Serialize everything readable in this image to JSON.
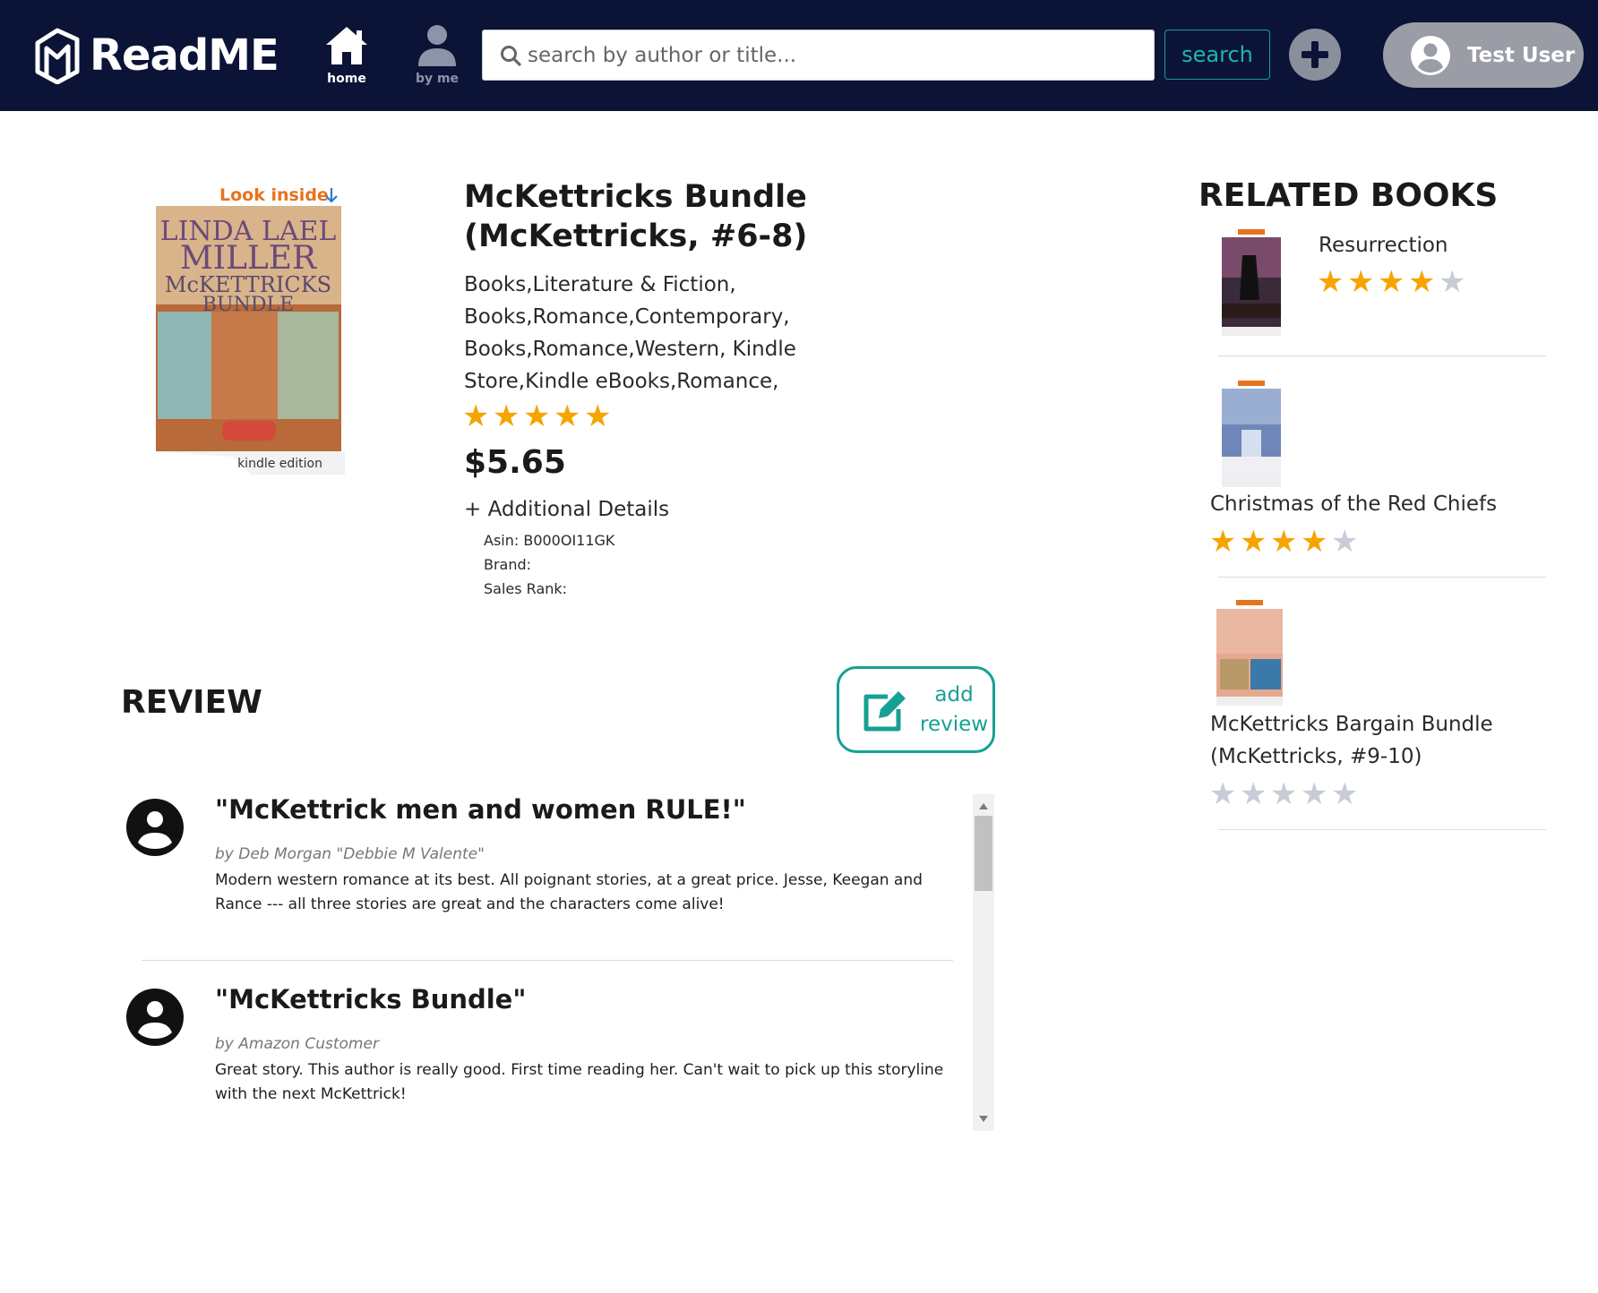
{
  "navbar": {
    "brand": "ReadME",
    "home_label": "home",
    "byme_label": "by me",
    "search_placeholder": "search by author or title...",
    "search_button": "search",
    "user_name": "Test User",
    "colors": {
      "background": "#0b1437",
      "accent": "#22b3b3"
    }
  },
  "book": {
    "title": "McKettricks Bundle (McKettricks, #6-8)",
    "categories": "Books,Literature & Fiction, Books,Romance,Contemporary, Books,Romance,Western, Kindle Store,Kindle eBooks,Romance,",
    "rating": 5,
    "price": "$5.65",
    "additional_details_label": "+ Additional Details",
    "details": {
      "asin": "Asin: B000OI11GK",
      "brand": "Brand:",
      "sales_rank": "Sales Rank:"
    },
    "cover": {
      "look_inside": "Look inside",
      "kindle_edition": "kindle edition",
      "author": "LINDA LAEL MILLER",
      "series": "McKETTRICKS BUNDLE"
    }
  },
  "reviews": {
    "heading": "REVIEW",
    "add_review_label_line1": "add",
    "add_review_label_line2": "review",
    "items": [
      {
        "title": "\"McKettrick men and women RULE!\"",
        "author": "by Deb Morgan \"Debbie M Valente\"",
        "text": "Modern western romance at its best. All poignant stories, at a great price. Jesse, Keegan and Rance --- all three stories are great and the characters come alive!"
      },
      {
        "title": "\"McKettricks Bundle\"",
        "author": "by Amazon Customer",
        "text": "Great story. This author is really good. First time reading her. Can't wait to pick up this storyline with the next McKettrick!"
      }
    ]
  },
  "related": {
    "heading": "RELATED BOOKS",
    "items": [
      {
        "title": "Resurrection",
        "rating": 4
      },
      {
        "title": "Christmas of the Red Chiefs",
        "rating": 4
      },
      {
        "title": "McKettricks Bargain Bundle (McKettricks, #9-10)",
        "rating": 0
      }
    ]
  },
  "colors": {
    "star_on": "#f6a400",
    "star_off": "#c8ccd6",
    "teal": "#17a094"
  }
}
